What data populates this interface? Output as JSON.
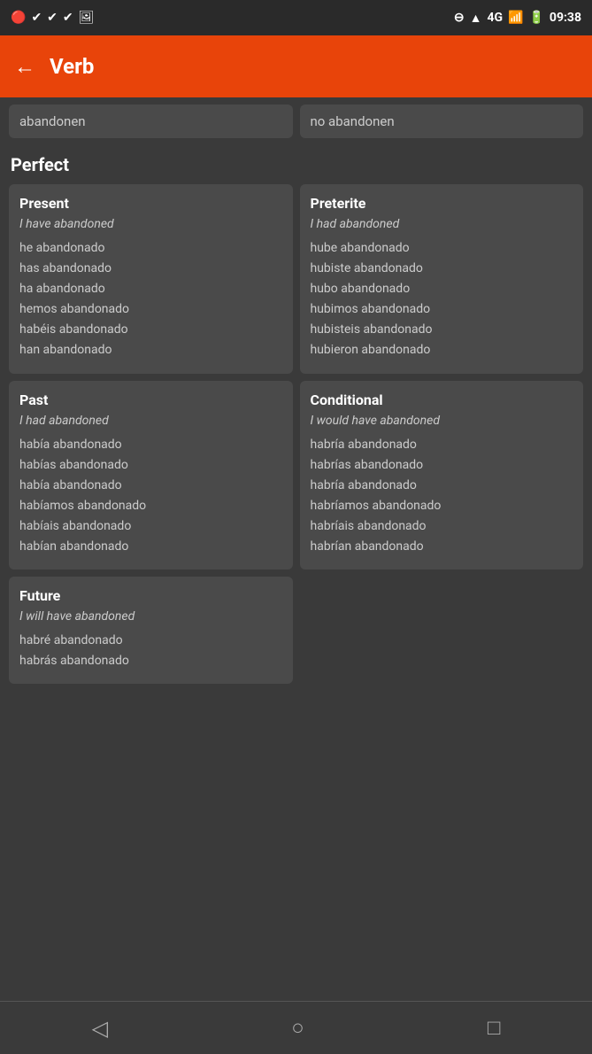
{
  "statusBar": {
    "time": "09:38",
    "network": "4G"
  },
  "appBar": {
    "title": "Verb",
    "backLabel": "←"
  },
  "topRow": {
    "left": "abandonen",
    "right": "no abandonen"
  },
  "sectionHeader": "Perfect",
  "presentCell": {
    "title": "Present",
    "subtitle": "I have abandoned",
    "items": [
      "he abandonado",
      "has abandonado",
      "ha abandonado",
      "hemos abandonado",
      "habéis abandonado",
      "han abandonado"
    ]
  },
  "preteriteCell": {
    "title": "Preterite",
    "subtitle": "I had abandoned",
    "items": [
      "hube abandonado",
      "hubiste abandonado",
      "hubo abandonado",
      "hubimos abandonado",
      "hubisteis abandonado",
      "hubieron abandonado"
    ]
  },
  "pastCell": {
    "title": "Past",
    "subtitle": "I had abandoned",
    "items": [
      "había abandonado",
      "habías abandonado",
      "había abandonado",
      "habíamos abandonado",
      "habíais abandonado",
      "habían abandonado"
    ]
  },
  "conditionalCell": {
    "title": "Conditional",
    "subtitle": "I would have abandoned",
    "items": [
      "habría abandonado",
      "habrías abandonado",
      "habría abandonado",
      "habríamos abandonado",
      "habríais abandonado",
      "habrían abandonado"
    ]
  },
  "futureCell": {
    "title": "Future",
    "subtitle": "I will have abandoned",
    "items": [
      "habré abandonado",
      "habrás abandonado"
    ]
  },
  "navBar": {
    "back": "◁",
    "home": "○",
    "recent": "□"
  }
}
